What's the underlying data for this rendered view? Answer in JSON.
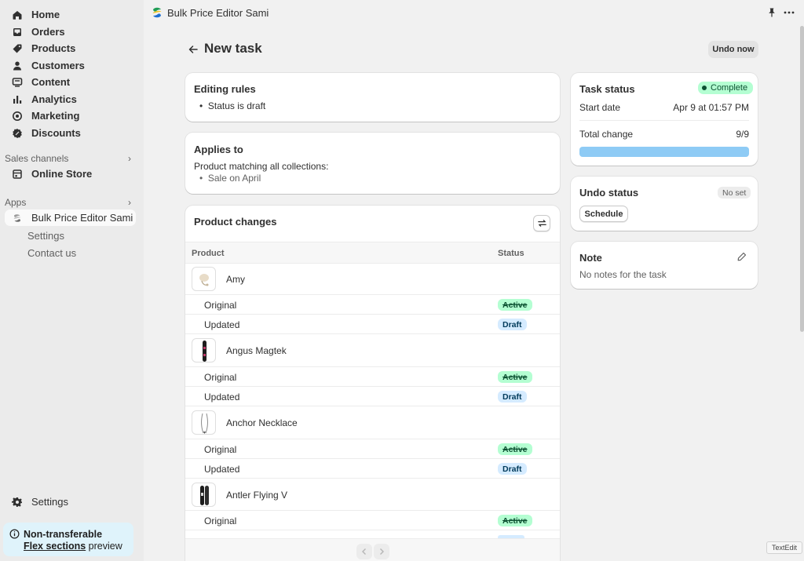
{
  "sidebar": {
    "nav": [
      {
        "label": "Home",
        "icon": "home-icon"
      },
      {
        "label": "Orders",
        "icon": "inbox-icon"
      },
      {
        "label": "Products",
        "icon": "tag-icon"
      },
      {
        "label": "Customers",
        "icon": "person-icon"
      },
      {
        "label": "Content",
        "icon": "content-icon"
      },
      {
        "label": "Analytics",
        "icon": "bar-chart-icon"
      },
      {
        "label": "Marketing",
        "icon": "target-icon"
      },
      {
        "label": "Discounts",
        "icon": "discount-icon"
      }
    ],
    "sales_channels_label": "Sales channels",
    "online_store_label": "Online Store",
    "apps_label": "Apps",
    "app_item_label": "Bulk Price Editor Sami",
    "app_sub_items": [
      "Settings",
      "Contact us"
    ],
    "settings_label": "Settings",
    "notice": {
      "title": "Non-transferable",
      "link": "Flex sections",
      "suffix": " preview"
    }
  },
  "topbar": {
    "app_title": "Bulk Price Editor Sami"
  },
  "page": {
    "title": "New task",
    "undo_now_label": "Undo now"
  },
  "editing_rules": {
    "title": "Editing rules",
    "rules": [
      "Status is draft"
    ]
  },
  "applies_to": {
    "title": "Applies to",
    "description": "Product matching all collections:",
    "items": [
      "Sale on April"
    ]
  },
  "product_changes": {
    "title": "Product changes",
    "columns": [
      "Product",
      "Status"
    ],
    "original_label": "Original",
    "updated_label": "Updated",
    "products": [
      {
        "name": "Amy",
        "original": "Active",
        "updated": "Draft"
      },
      {
        "name": "Angus Magtek",
        "original": "Active",
        "updated": "Draft"
      },
      {
        "name": "Anchor Necklace",
        "original": "Active",
        "updated": "Draft"
      },
      {
        "name": "Antler Flying V",
        "original": "Active",
        "updated": "Draft"
      }
    ]
  },
  "task_status": {
    "title": "Task status",
    "status": "Complete",
    "start_date_label": "Start date",
    "start_date": "Apr 9 at 01:57 PM",
    "total_change_label": "Total change",
    "total_change": "9/9",
    "progress_fraction": 1.0
  },
  "undo_status": {
    "title": "Undo status",
    "badge": "No set",
    "schedule_label": "Schedule"
  },
  "note": {
    "title": "Note",
    "text": "No notes for the task"
  },
  "dock_tooltip": "TextEdit",
  "colors": {
    "accent_green": "#b4fed2",
    "draft_blue": "#d5ebff",
    "progress_blue": "#8ecbf5"
  }
}
